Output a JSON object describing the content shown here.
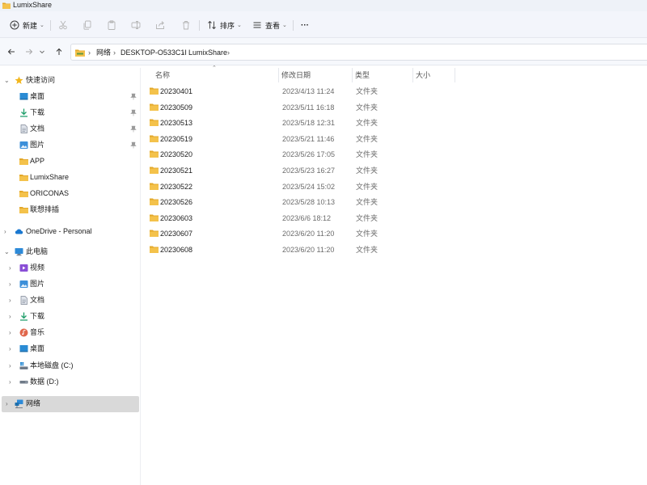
{
  "window": {
    "title": "LumixShare"
  },
  "toolbar": {
    "new_label": "新建",
    "sort_label": "排序",
    "view_label": "查看",
    "more_label": "···"
  },
  "address": {
    "crumbs": [
      "网络",
      "DESKTOP-O533C1I",
      "LumixShare"
    ]
  },
  "sidebar": {
    "quick_access": "快速访问",
    "quick_items": [
      {
        "label": "桌面",
        "icon": "desktop-icon",
        "pinned": true
      },
      {
        "label": "下载",
        "icon": "download-icon",
        "pinned": true
      },
      {
        "label": "文档",
        "icon": "document-icon",
        "pinned": true
      },
      {
        "label": "图片",
        "icon": "picture-icon",
        "pinned": true
      },
      {
        "label": "APP",
        "icon": "folder-icon",
        "pinned": false
      },
      {
        "label": "LumixShare",
        "icon": "folder-icon",
        "pinned": false
      },
      {
        "label": "ORICONAS",
        "icon": "folder-icon",
        "pinned": false
      },
      {
        "label": "联想排插",
        "icon": "folder-icon",
        "pinned": false
      }
    ],
    "onedrive": "OneDrive - Personal",
    "this_pc": "此电脑",
    "pc_items": [
      {
        "label": "视频",
        "icon": "video-icon"
      },
      {
        "label": "图片",
        "icon": "picture-icon"
      },
      {
        "label": "文档",
        "icon": "document-icon"
      },
      {
        "label": "下载",
        "icon": "download-icon"
      },
      {
        "label": "音乐",
        "icon": "music-icon"
      },
      {
        "label": "桌面",
        "icon": "desktop-icon"
      },
      {
        "label": "本地磁盘 (C:)",
        "icon": "system-drive-icon"
      },
      {
        "label": "数据 (D:)",
        "icon": "drive-icon"
      }
    ],
    "network": "网络"
  },
  "columns": {
    "name": "名称",
    "modified": "修改日期",
    "type": "类型",
    "size": "大小"
  },
  "files": [
    {
      "name": "20230401",
      "modified": "2023/4/13 11:24",
      "type": "文件夹"
    },
    {
      "name": "20230509",
      "modified": "2023/5/11 16:18",
      "type": "文件夹"
    },
    {
      "name": "20230513",
      "modified": "2023/5/18 12:31",
      "type": "文件夹"
    },
    {
      "name": "20230519",
      "modified": "2023/5/21 11:46",
      "type": "文件夹"
    },
    {
      "name": "20230520",
      "modified": "2023/5/26 17:05",
      "type": "文件夹"
    },
    {
      "name": "20230521",
      "modified": "2023/5/23 16:27",
      "type": "文件夹"
    },
    {
      "name": "20230522",
      "modified": "2023/5/24 15:02",
      "type": "文件夹"
    },
    {
      "name": "20230526",
      "modified": "2023/5/28 10:13",
      "type": "文件夹"
    },
    {
      "name": "20230603",
      "modified": "2023/6/6 18:12",
      "type": "文件夹"
    },
    {
      "name": "20230607",
      "modified": "2023/6/20 11:20",
      "type": "文件夹"
    },
    {
      "name": "20230608",
      "modified": "2023/6/20 11:20",
      "type": "文件夹"
    }
  ],
  "colors": {
    "folder": "#f4c24b",
    "folder_dark": "#e3a82a",
    "accent": "#0067c0",
    "selected": "#d9d9d9"
  }
}
